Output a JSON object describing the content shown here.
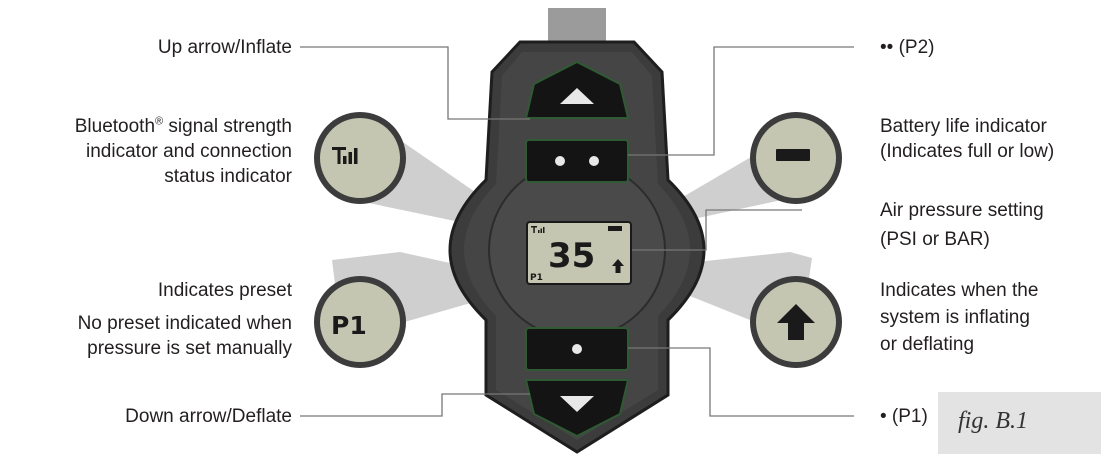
{
  "labels": {
    "up_arrow": "Up arrow/Inflate",
    "bluetooth_1": "Bluetooth",
    "bluetooth_reg": "®",
    "bluetooth_1b": " signal strength",
    "bluetooth_2": "indicator and connection",
    "bluetooth_3": "status indicator",
    "preset_1": "Indicates preset",
    "preset_2": "No preset indicated when",
    "preset_3": "pressure is set manually",
    "down_arrow": "Down arrow/Deflate",
    "p2": "•• (P2)",
    "battery_1": "Battery life indicator",
    "battery_2": "(Indicates full or low)",
    "air_1": "Air pressure setting",
    "air_2": "(PSI or BAR)",
    "inflate_1": "Indicates when the",
    "inflate_2": "system is inflating",
    "inflate_3": "or deflating",
    "p1": "• (P1)"
  },
  "display": {
    "pressure": "35",
    "preset": "P1",
    "preset_zoom": "P1"
  },
  "figure_caption": "fig. B.1",
  "colors": {
    "body": "#3a3a3a",
    "button": "#141414",
    "button_edge": "#2e5a34",
    "lcd": "#c4c6b2",
    "callout": "#cfcfcf"
  },
  "icons": [
    "up-arrow-icon",
    "dot-icon",
    "down-arrow-icon",
    "signal-strength-icon",
    "battery-icon",
    "inflate-arrow-icon"
  ]
}
